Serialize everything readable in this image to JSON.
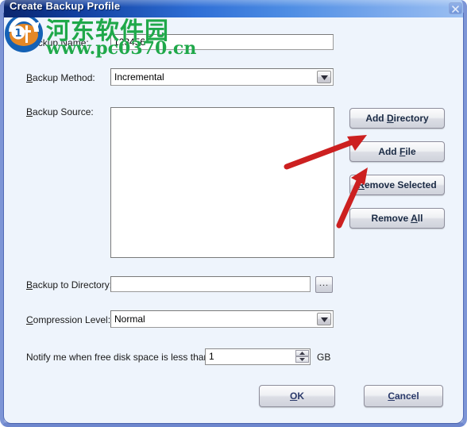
{
  "window": {
    "title": "Create Backup Profile",
    "close_icon": "close-icon"
  },
  "watermark": {
    "cn_text": "河东软件园",
    "url_text": "www.pc0370.cn"
  },
  "form": {
    "backup_name": {
      "label": "Backup Name:",
      "accel": "B",
      "label_rest": "ackup Name:",
      "value": "123456"
    },
    "backup_method": {
      "label_accel": "B",
      "label_rest": "ackup Method:",
      "value": "Incremental",
      "arrow_icon": "chevron-down-icon"
    },
    "backup_source": {
      "label_accel": "B",
      "label_rest": "ackup Source:",
      "items": []
    },
    "backup_to_directory": {
      "label_accel": "B",
      "label_rest": "ackup to Directory:",
      "value": "",
      "browse_label": "...",
      "browse_icon": "ellipsis-icon"
    },
    "compression_level": {
      "label_accel": "C",
      "label_rest": "ompression Level:",
      "value": "Normal",
      "arrow_icon": "chevron-down-icon"
    },
    "free_space_notify": {
      "label": "Notify me when free disk space is less than:",
      "value": "1",
      "unit": "GB",
      "up_icon": "spinner-up-icon",
      "down_icon": "spinner-down-icon"
    }
  },
  "source_buttons": [
    {
      "name": "add-directory-button",
      "accel": "D",
      "before": "Add ",
      "after": "irectory"
    },
    {
      "name": "add-file-button",
      "accel": "F",
      "before": "Add ",
      "after": "ile"
    },
    {
      "name": "remove-selected-button",
      "accel": "R",
      "before": "",
      "after": "emove Selected"
    },
    {
      "name": "remove-all-button",
      "accel": "A",
      "before": "Remove ",
      "after": "ll"
    }
  ],
  "dialog_buttons": {
    "ok": {
      "accel": "O",
      "before": "",
      "after": "K"
    },
    "cancel": {
      "accel": "C",
      "before": "",
      "after": "ancel"
    }
  },
  "colors": {
    "titlebar_start": "#0a246a",
    "titlebar_end": "#9cc0f2",
    "client_bg": "#eef4fc",
    "frame_blue": "#7d95d6",
    "annotation_red": "#cc2020",
    "watermark_green": "#1fa84a"
  }
}
